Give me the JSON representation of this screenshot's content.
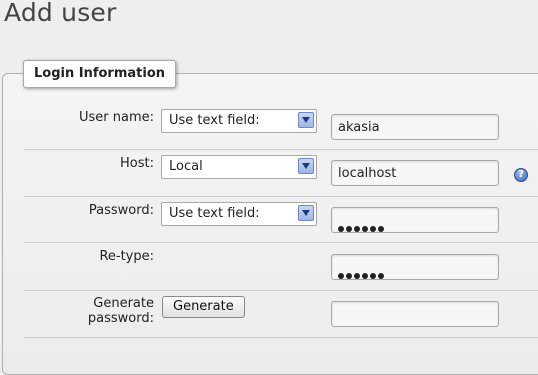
{
  "page": {
    "title": "Add user"
  },
  "fieldset": {
    "legend": "Login Information"
  },
  "form": {
    "username": {
      "label": "User name:",
      "mode": "Use text field:",
      "value": "akasia"
    },
    "host": {
      "label": "Host:",
      "mode": "Local",
      "value": "localhost"
    },
    "password": {
      "label": "Password:",
      "mode": "Use text field:",
      "masked_length": 6
    },
    "retype": {
      "label": "Re-type:",
      "masked_length": 6
    },
    "generate": {
      "label_line1": "Generate",
      "label_line2": "password:",
      "button": "Generate",
      "value": ""
    }
  },
  "icons": {
    "select_arrow": "chevron-down-icon",
    "help": "help-icon"
  },
  "colors": {
    "background": "#eeeeee",
    "select_arrow": "#9fb5e6",
    "help_icon": "#2f63b6"
  }
}
